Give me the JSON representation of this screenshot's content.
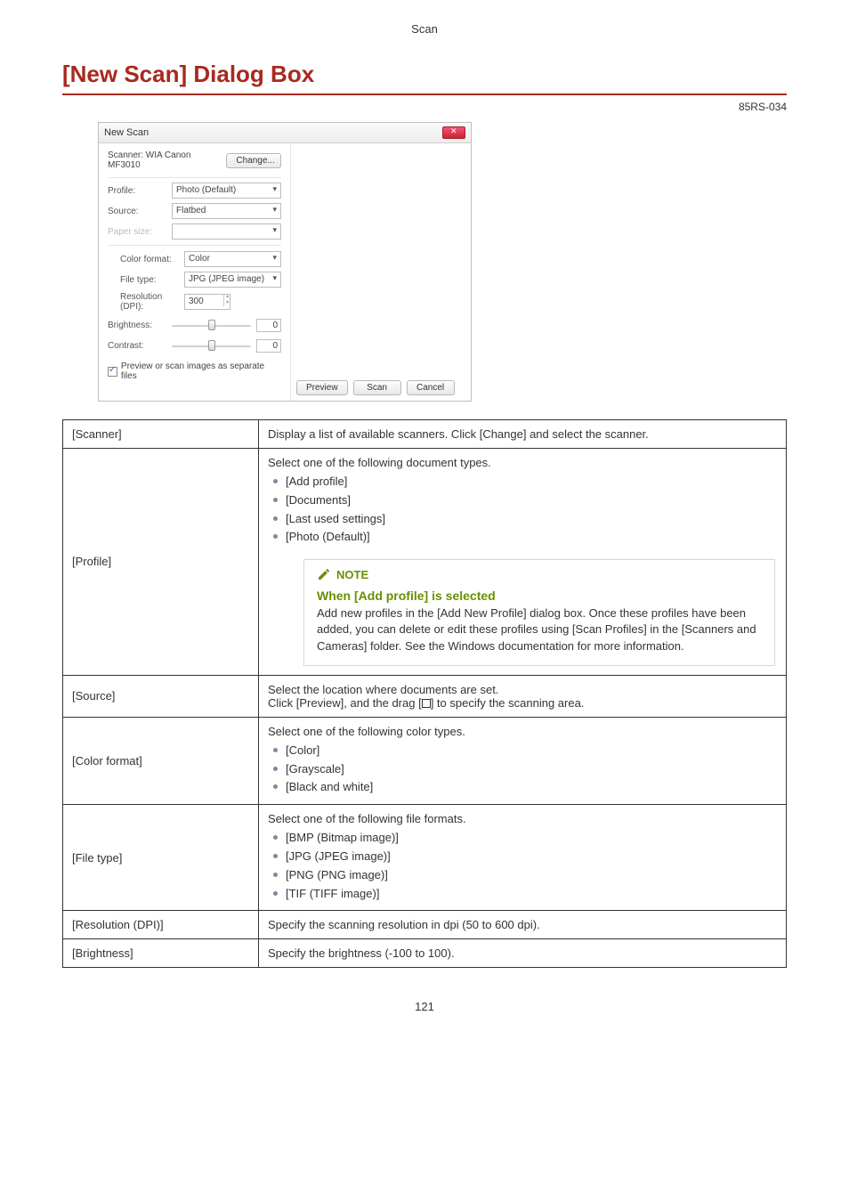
{
  "header": {
    "section": "Scan"
  },
  "title": "[New Scan] Dialog Box",
  "doc_id": "85RS-034",
  "page_number": "121",
  "dialog": {
    "window_title": "New Scan",
    "scanner_label": "Scanner: WIA Canon MF3010",
    "change_btn": "Change...",
    "rows": {
      "profile_label": "Profile:",
      "profile_value": "Photo (Default)",
      "source_label": "Source:",
      "source_value": "Flatbed",
      "papersize_label": "Paper size:",
      "papersize_value": "",
      "colorformat_label": "Color format:",
      "colorformat_value": "Color",
      "filetype_label": "File type:",
      "filetype_value": "JPG (JPEG image)",
      "resolution_label": "Resolution (DPI):",
      "resolution_value": "300",
      "brightness_label": "Brightness:",
      "brightness_value": "0",
      "contrast_label": "Contrast:",
      "contrast_value": "0"
    },
    "checkbox_label": "Preview or scan images as separate files",
    "buttons": {
      "preview": "Preview",
      "scan": "Scan",
      "cancel": "Cancel"
    }
  },
  "table": {
    "scanner": {
      "key": "[Scanner]",
      "desc": "Display a list of available scanners. Click [Change] and select the scanner."
    },
    "profile": {
      "key": "[Profile]",
      "intro": "Select one of the following document types.",
      "items": [
        "[Add profile]",
        "[Documents]",
        "[Last used settings]",
        "[Photo (Default)]"
      ],
      "note": {
        "title": "NOTE",
        "subtitle": "When [Add profile] is selected",
        "body": "Add new profiles in the [Add New Profile] dialog box. Once these profiles have been added, you can delete or edit these profiles using [Scan Profiles] in the [Scanners and Cameras] folder. See the Windows documentation for more information."
      }
    },
    "source": {
      "key": "[Source]",
      "line1": "Select the location where documents are set.",
      "line2a": "Click [Preview], and the drag [",
      "line2b": "] to specify the scanning area."
    },
    "colorformat": {
      "key": "[Color format]",
      "intro": "Select one of the following color types.",
      "items": [
        "[Color]",
        "[Grayscale]",
        "[Black and white]"
      ]
    },
    "filetype": {
      "key": "[File type]",
      "intro": "Select one of the following file formats.",
      "items": [
        "[BMP (Bitmap image)]",
        "[JPG (JPEG image)]",
        "[PNG (PNG image)]",
        "[TIF (TIFF image)]"
      ]
    },
    "resolution": {
      "key": "[Resolution (DPI)]",
      "desc": "Specify the scanning resolution in dpi (50 to 600 dpi)."
    },
    "brightness": {
      "key": "[Brightness]",
      "desc": "Specify the brightness (-100 to 100)."
    }
  }
}
